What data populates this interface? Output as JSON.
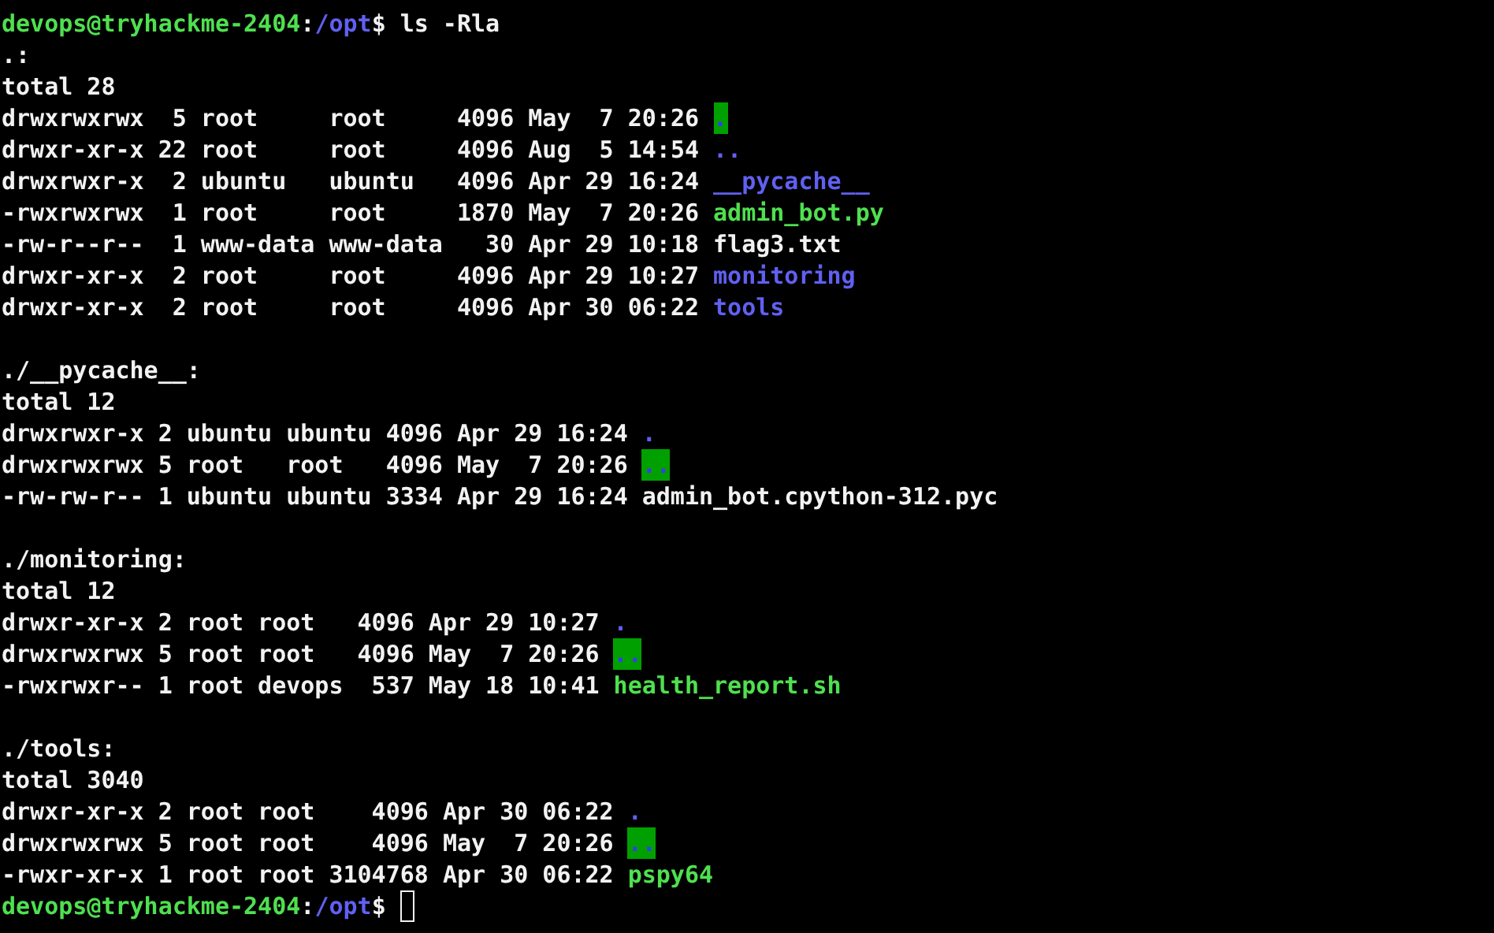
{
  "terminal": {
    "lines": [
      {
        "kind": "prompt",
        "user_host": "devops@tryhackme-2404",
        "separator": ":",
        "path": "/opt",
        "symbol": "$",
        "command": "ls -Rla"
      },
      {
        "kind": "text",
        "text": ".:"
      },
      {
        "kind": "text",
        "text": "total 28"
      },
      {
        "kind": "entry",
        "info": "drwxrwxrwx  5 root     root     4096 May  7 20:26",
        "name": {
          "text": ".",
          "kind": "dir_other_writable"
        }
      },
      {
        "kind": "entry",
        "info": "drwxr-xr-x 22 root     root     4096 Aug  5 14:54",
        "name": {
          "text": "..",
          "kind": "dir"
        }
      },
      {
        "kind": "entry",
        "info": "drwxrwxr-x  2 ubuntu   ubuntu   4096 Apr 29 16:24",
        "name": {
          "text": "__pycache__",
          "kind": "dir"
        }
      },
      {
        "kind": "entry",
        "info": "-rwxrwxrwx  1 root     root     1870 May  7 20:26",
        "name": {
          "text": "admin_bot.py",
          "kind": "exec"
        }
      },
      {
        "kind": "entry",
        "info": "-rw-r--r--  1 www-data www-data   30 Apr 29 10:18",
        "name": {
          "text": "flag3.txt",
          "kind": "file"
        }
      },
      {
        "kind": "entry",
        "info": "drwxr-xr-x  2 root     root     4096 Apr 29 10:27",
        "name": {
          "text": "monitoring",
          "kind": "dir"
        }
      },
      {
        "kind": "entry",
        "info": "drwxr-xr-x  2 root     root     4096 Apr 30 06:22",
        "name": {
          "text": "tools",
          "kind": "dir"
        }
      },
      {
        "kind": "blank"
      },
      {
        "kind": "text",
        "text": "./__pycache__:"
      },
      {
        "kind": "text",
        "text": "total 12"
      },
      {
        "kind": "entry",
        "info": "drwxrwxr-x 2 ubuntu ubuntu 4096 Apr 29 16:24",
        "name": {
          "text": ".",
          "kind": "dir"
        }
      },
      {
        "kind": "entry",
        "info": "drwxrwxrwx 5 root   root   4096 May  7 20:26",
        "name": {
          "text": "..",
          "kind": "dir_other_writable"
        }
      },
      {
        "kind": "entry",
        "info": "-rw-rw-r-- 1 ubuntu ubuntu 3334 Apr 29 16:24",
        "name": {
          "text": "admin_bot.cpython-312.pyc",
          "kind": "file"
        }
      },
      {
        "kind": "blank"
      },
      {
        "kind": "text",
        "text": "./monitoring:"
      },
      {
        "kind": "text",
        "text": "total 12"
      },
      {
        "kind": "entry",
        "info": "drwxr-xr-x 2 root root   4096 Apr 29 10:27",
        "name": {
          "text": ".",
          "kind": "dir"
        }
      },
      {
        "kind": "entry",
        "info": "drwxrwxrwx 5 root root   4096 May  7 20:26",
        "name": {
          "text": "..",
          "kind": "dir_other_writable"
        }
      },
      {
        "kind": "entry",
        "info": "-rwxrwxr-- 1 root devops  537 May 18 10:41",
        "name": {
          "text": "health_report.sh",
          "kind": "exec"
        }
      },
      {
        "kind": "blank"
      },
      {
        "kind": "text",
        "text": "./tools:"
      },
      {
        "kind": "text",
        "text": "total 3040"
      },
      {
        "kind": "entry",
        "info": "drwxr-xr-x 2 root root    4096 Apr 30 06:22",
        "name": {
          "text": ".",
          "kind": "dir"
        }
      },
      {
        "kind": "entry",
        "info": "drwxrwxrwx 5 root root    4096 May  7 20:26",
        "name": {
          "text": "..",
          "kind": "dir_other_writable"
        }
      },
      {
        "kind": "entry",
        "info": "-rwxr-xr-x 1 root root 3104768 Apr 30 06:22",
        "name": {
          "text": "pspy64",
          "kind": "exec"
        }
      },
      {
        "kind": "prompt",
        "user_host": "devops@tryhackme-2404",
        "separator": ":",
        "path": "/opt",
        "symbol": "$",
        "cursor": true
      }
    ]
  }
}
